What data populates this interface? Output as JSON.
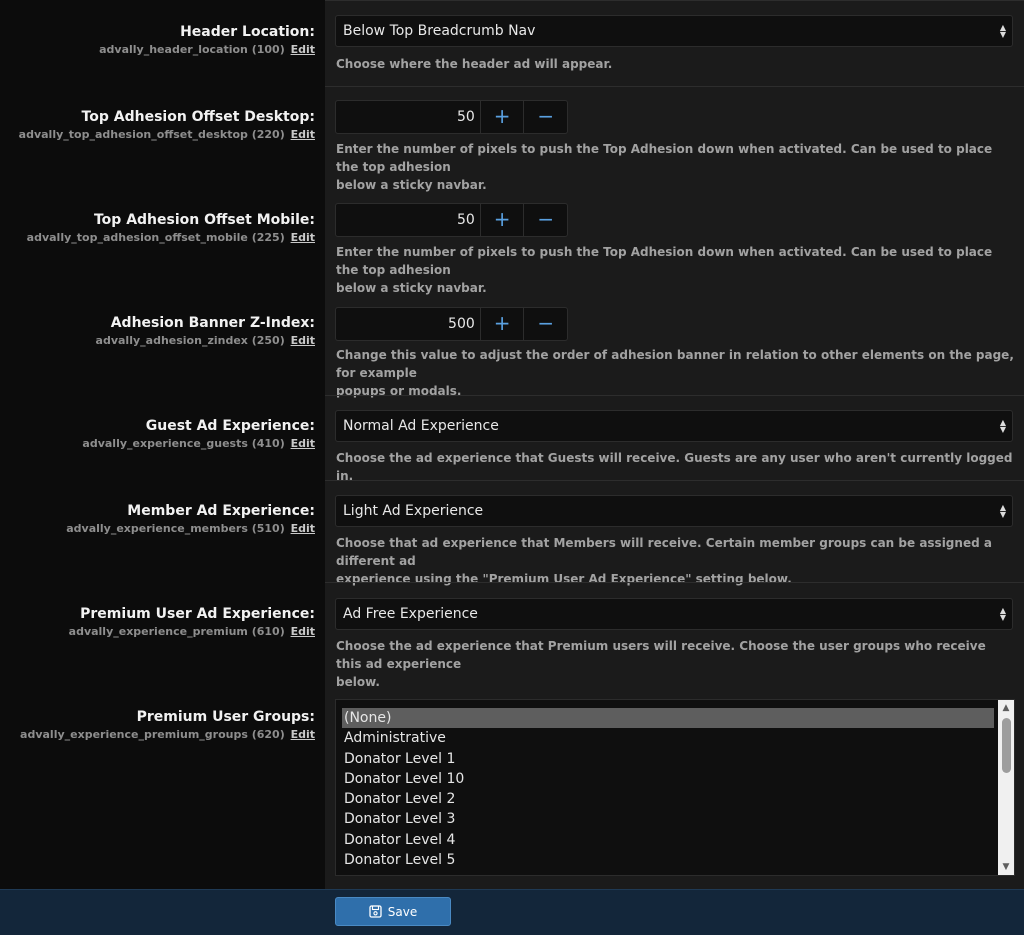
{
  "settings": {
    "header_location": {
      "title": "Header Location:",
      "key": "advally_header_location (100)",
      "edit": "Edit",
      "value": "Below Top Breadcrumb Nav",
      "help": "Choose where the header ad will appear."
    },
    "offset_desktop": {
      "title": "Top Adhesion Offset Desktop:",
      "key": "advally_top_adhesion_offset_desktop (220)",
      "edit": "Edit",
      "value": "50",
      "plus": "+",
      "minus": "−",
      "help_line1": "Enter the number of pixels to push the Top Adhesion down when activated. Can be used to place the top adhesion",
      "help_line2": "below a sticky navbar."
    },
    "offset_mobile": {
      "title": "Top Adhesion Offset Mobile:",
      "key": "advally_top_adhesion_offset_mobile (225)",
      "edit": "Edit",
      "value": "50",
      "plus": "+",
      "minus": "−",
      "help_line1": "Enter the number of pixels to push the Top Adhesion down when activated. Can be used to place the top adhesion",
      "help_line2": "below a sticky navbar."
    },
    "zindex": {
      "title": "Adhesion Banner Z-Index:",
      "key": "advally_adhesion_zindex (250)",
      "edit": "Edit",
      "value": "500",
      "plus": "+",
      "minus": "−",
      "help_line1": "Change this value to adjust the order of adhesion banner in relation to other elements on the page, for example",
      "help_line2": "popups or modals."
    },
    "guest": {
      "title": "Guest Ad Experience:",
      "key": "advally_experience_guests (410)",
      "edit": "Edit",
      "value": "Normal Ad Experience",
      "help": "Choose the ad experience that Guests will receive. Guests are any user who aren't currently logged in."
    },
    "member": {
      "title": "Member Ad Experience:",
      "key": "advally_experience_members (510)",
      "edit": "Edit",
      "value": "Light Ad Experience",
      "help_line1": "Choose that ad experience that Members will receive. Certain member groups can be assigned a different ad",
      "help_line2": "experience using the \"Premium User Ad Experience\" setting below."
    },
    "premium": {
      "title": "Premium User Ad Experience:",
      "key": "advally_experience_premium (610)",
      "edit": "Edit",
      "value": "Ad Free Experience",
      "help_line1": "Choose the ad experience that Premium users will receive. Choose the user groups who receive this ad experience",
      "help_line2": "below."
    },
    "premium_groups": {
      "title": "Premium User Groups:",
      "key": "advally_experience_premium_groups (620)",
      "edit": "Edit",
      "options": [
        "(None)",
        "Administrative",
        "Donator Level 1",
        "Donator Level 10",
        "Donator Level 2",
        "Donator Level 3",
        "Donator Level 4",
        "Donator Level 5"
      ],
      "selected": "(None)"
    }
  },
  "footer": {
    "save_label": "Save",
    "save_icon": "save-icon"
  },
  "colors": {
    "accent": "#2f6fab",
    "footer_bg": "#13263a",
    "row_bg": "#1b1b1b"
  }
}
